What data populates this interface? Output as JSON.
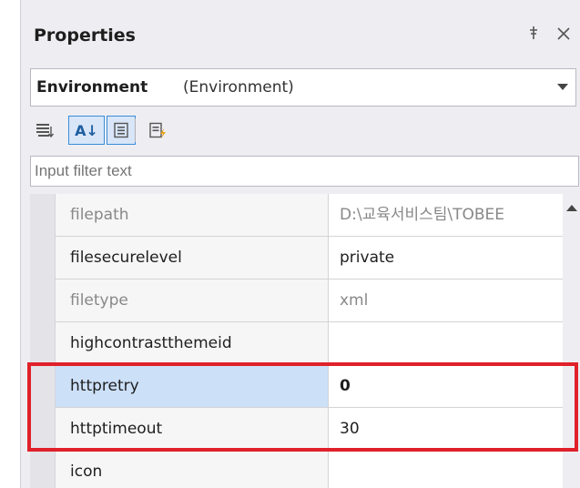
{
  "panel": {
    "title": "Properties",
    "pin_glyph": "†",
    "close_glyph": "✕"
  },
  "object_selector": {
    "name": "Environment",
    "type": "(Environment)"
  },
  "toolbar": {
    "buttons": [
      {
        "icon": "categorized-icon",
        "active": false
      },
      {
        "icon": "alphabetical-icon",
        "active": true
      },
      {
        "icon": "properties-icon",
        "active": true
      },
      {
        "icon": "events-icon",
        "active": false
      }
    ],
    "alpha_label": "A↓"
  },
  "filter": {
    "placeholder": "Input filter text",
    "value": ""
  },
  "properties": [
    {
      "name": "filepath",
      "value": "D:\\교육서비스팀\\TOBEE",
      "readonly": true
    },
    {
      "name": "filesecurelevel",
      "value": "private",
      "readonly": false
    },
    {
      "name": "filetype",
      "value": "xml",
      "readonly": true
    },
    {
      "name": "highcontrastthemeid",
      "value": "",
      "readonly": false
    },
    {
      "name": "httpretry",
      "value": "0",
      "readonly": false,
      "selected": true
    },
    {
      "name": "httptimeout",
      "value": "30",
      "readonly": false
    },
    {
      "name": "icon",
      "value": "",
      "readonly": false
    }
  ],
  "colors": {
    "highlight": "#e0202a",
    "selected_row": "#cce0f8",
    "accent": "#3b8cd8"
  }
}
